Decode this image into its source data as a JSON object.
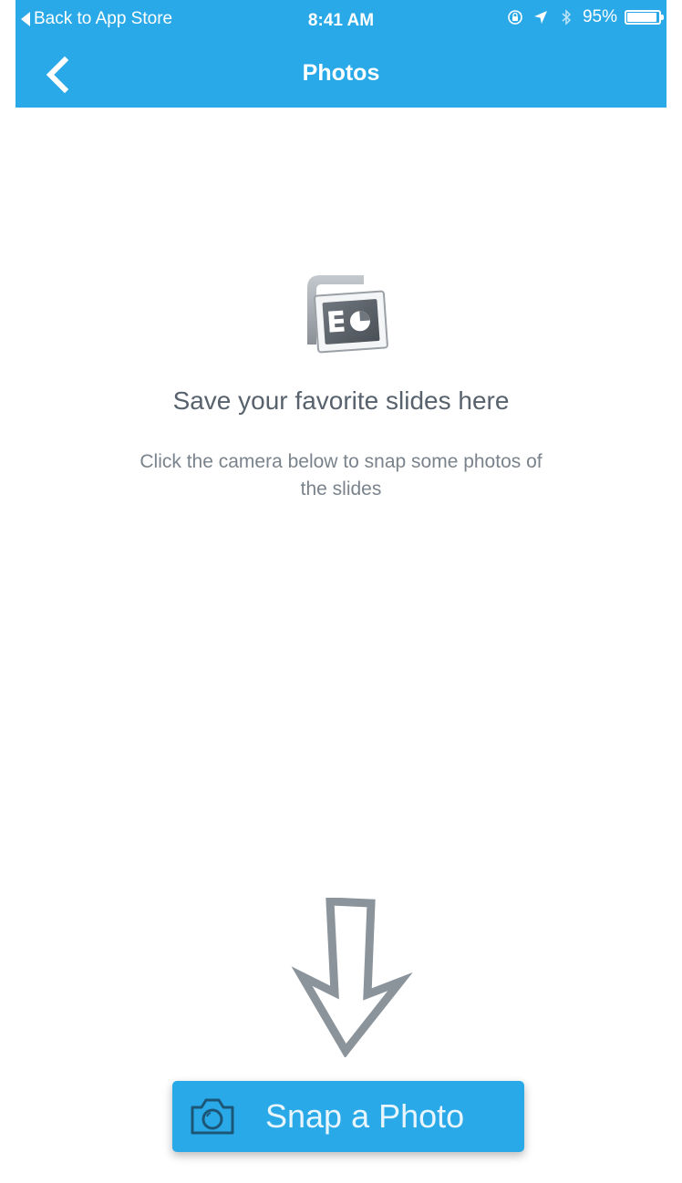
{
  "status_bar": {
    "back_label": "Back to App Store",
    "time": "8:41 AM",
    "battery": "95%",
    "battery_level": 0.95,
    "icons": [
      "rotation-lock-icon",
      "location-arrow-icon",
      "bluetooth-icon",
      "battery-icon"
    ]
  },
  "nav": {
    "title": "Photos",
    "back_icon": "chevron-left-icon"
  },
  "empty_state": {
    "icon": "presentation-slides-icon",
    "title": "Save your favorite slides here",
    "subtitle": "Click the camera below to snap some photos of the slides"
  },
  "hint": {
    "icon": "down-arrow-icon"
  },
  "snap_button": {
    "label": "Snap a Photo",
    "icon": "camera-icon"
  },
  "colors": {
    "accent": "#2aa9e8",
    "text_primary": "#58626d",
    "text_secondary": "#7a838c"
  }
}
